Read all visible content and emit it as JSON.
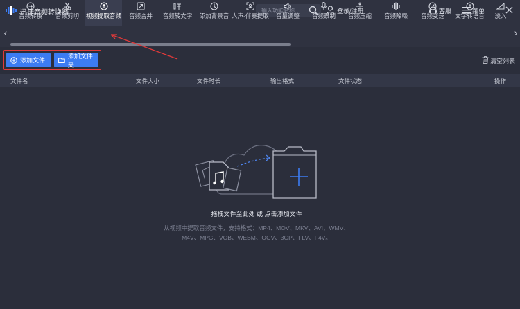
{
  "app": {
    "title": "迅捷音频转换器"
  },
  "titlebar": {
    "search_placeholder": "输入功能名称",
    "login_label": "登录/注册",
    "service_label": "客服",
    "menu_label": "菜单"
  },
  "toolbar": {
    "items": [
      {
        "label": "音频转换",
        "icon": "convert-icon"
      },
      {
        "label": "音频剪切",
        "icon": "scissors-icon"
      },
      {
        "label": "视频提取音频",
        "icon": "extract-icon"
      },
      {
        "label": "音频合并",
        "icon": "merge-icon"
      },
      {
        "label": "音频转文字",
        "icon": "speech-text-icon"
      },
      {
        "label": "添加背景音",
        "icon": "background-music-icon"
      },
      {
        "label": "人声-伴奏提取",
        "icon": "vocal-icon"
      },
      {
        "label": "音量调整",
        "icon": "volume-icon"
      },
      {
        "label": "音频录制",
        "icon": "microphone-icon"
      },
      {
        "label": "音频压缩",
        "icon": "compress-icon"
      },
      {
        "label": "音频降噪",
        "icon": "denoise-icon"
      },
      {
        "label": "音频变速",
        "icon": "speed-icon"
      },
      {
        "label": "文字转语音",
        "icon": "text-speech-icon"
      },
      {
        "label": "淡入",
        "icon": "fade-icon"
      }
    ],
    "active_index": 2
  },
  "actions": {
    "add_file": "添加文件",
    "add_folder": "添加文件夹",
    "clear_list": "清空列表"
  },
  "table": {
    "columns": [
      "文件名",
      "文件大小",
      "文件时长",
      "输出格式",
      "文件状态",
      "操作"
    ]
  },
  "empty": {
    "drag_text": "拖拽文件至此处 或 点击添加文件",
    "hint_line1": "从视频中提取音频文件，支持格式：MP4、MOV、MKV、AVI、WMV、",
    "hint_line2": "M4V、MPG、VOB、WEBM、OGV、3GP、FLV、F4V。"
  },
  "colors": {
    "accent": "#3c7cf2",
    "annotation": "#e23a3a",
    "background": "#2b2e3b",
    "bar": "#2f3240"
  }
}
